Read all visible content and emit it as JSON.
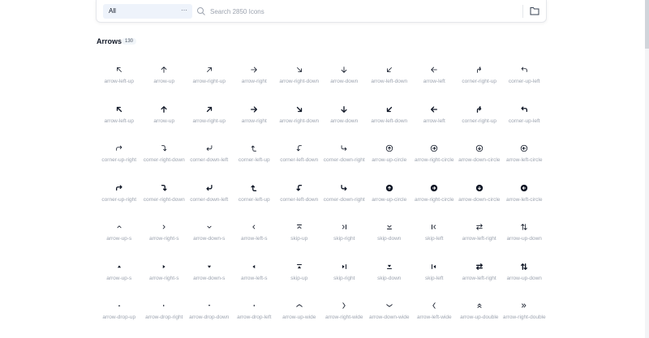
{
  "toolbar": {
    "category_select": "All",
    "search_placeholder": "Search 2850 Icons"
  },
  "section": {
    "title": "Arrows",
    "count": "130"
  },
  "rows": [
    [
      {
        "label": "arrow-left-up",
        "icon": "arrow-left-up-icon"
      },
      {
        "label": "arrow-up",
        "icon": "arrow-up-icon"
      },
      {
        "label": "arrow-right-up",
        "icon": "arrow-right-up-icon"
      },
      {
        "label": "arrow-right",
        "icon": "arrow-right-icon"
      },
      {
        "label": "arrow-right-down",
        "icon": "arrow-right-down-icon"
      },
      {
        "label": "arrow-down",
        "icon": "arrow-down-icon"
      },
      {
        "label": "arrow-left-down",
        "icon": "arrow-left-down-icon"
      },
      {
        "label": "arrow-left",
        "icon": "arrow-left-icon"
      },
      {
        "label": "corner-right-up",
        "icon": "corner-right-up-icon"
      },
      {
        "label": "corner-up-left",
        "icon": "corner-up-left-icon"
      }
    ],
    [
      {
        "label": "arrow-left-up",
        "icon": "arrow-left-up-bold-icon"
      },
      {
        "label": "arrow-up",
        "icon": "arrow-up-bold-icon"
      },
      {
        "label": "arrow-right-up",
        "icon": "arrow-right-up-bold-icon"
      },
      {
        "label": "arrow-right",
        "icon": "arrow-right-bold-icon"
      },
      {
        "label": "arrow-right-down",
        "icon": "arrow-right-down-bold-icon"
      },
      {
        "label": "arrow-down",
        "icon": "arrow-down-bold-icon"
      },
      {
        "label": "arrow-left-down",
        "icon": "arrow-left-down-bold-icon"
      },
      {
        "label": "arrow-left",
        "icon": "arrow-left-bold-icon"
      },
      {
        "label": "corner-right-up",
        "icon": "corner-right-up-bold-icon"
      },
      {
        "label": "corner-up-left",
        "icon": "corner-up-left-bold-icon"
      }
    ],
    [
      {
        "label": "corner-up-right",
        "icon": "corner-up-right-icon"
      },
      {
        "label": "corner-right-down",
        "icon": "corner-right-down-icon"
      },
      {
        "label": "corner-down-left",
        "icon": "corner-down-left-icon"
      },
      {
        "label": "corner-left-up",
        "icon": "corner-left-up-icon"
      },
      {
        "label": "corner-left-down",
        "icon": "corner-left-down-icon"
      },
      {
        "label": "corner-down-right",
        "icon": "corner-down-right-icon"
      },
      {
        "label": "arrow-up-circle",
        "icon": "arrow-up-circle-icon"
      },
      {
        "label": "arrow-right-circle",
        "icon": "arrow-right-circle-icon"
      },
      {
        "label": "arrow-down-circle",
        "icon": "arrow-down-circle-icon"
      },
      {
        "label": "arrow-left-circle",
        "icon": "arrow-left-circle-icon"
      }
    ],
    [
      {
        "label": "corner-up-right",
        "icon": "corner-up-right-bold-icon"
      },
      {
        "label": "corner-right-down",
        "icon": "corner-right-down-bold-icon"
      },
      {
        "label": "corner-down-left",
        "icon": "corner-down-left-bold-icon"
      },
      {
        "label": "corner-left-up",
        "icon": "corner-left-up-bold-icon"
      },
      {
        "label": "corner-left-down",
        "icon": "corner-left-down-bold-icon"
      },
      {
        "label": "corner-down-right",
        "icon": "corner-down-right-bold-icon"
      },
      {
        "label": "arrow-up-circle",
        "icon": "arrow-up-circle-filled-icon"
      },
      {
        "label": "arrow-right-circle",
        "icon": "arrow-right-circle-filled-icon"
      },
      {
        "label": "arrow-down-circle",
        "icon": "arrow-down-circle-filled-icon"
      },
      {
        "label": "arrow-left-circle",
        "icon": "arrow-left-circle-filled-icon"
      }
    ],
    [
      {
        "label": "arrow-up-s",
        "icon": "chevron-up-icon"
      },
      {
        "label": "arrow-right-s",
        "icon": "chevron-right-icon"
      },
      {
        "label": "arrow-down-s",
        "icon": "chevron-down-icon"
      },
      {
        "label": "arrow-left-s",
        "icon": "chevron-left-icon"
      },
      {
        "label": "skip-up",
        "icon": "skip-up-icon"
      },
      {
        "label": "skip-right",
        "icon": "skip-right-icon"
      },
      {
        "label": "skip-down",
        "icon": "skip-down-icon"
      },
      {
        "label": "skip-left",
        "icon": "skip-left-icon"
      },
      {
        "label": "arrow-left-right",
        "icon": "arrow-left-right-icon"
      },
      {
        "label": "arrow-up-down",
        "icon": "arrow-up-down-icon"
      }
    ],
    [
      {
        "label": "arrow-up-s",
        "icon": "triangle-up-icon"
      },
      {
        "label": "arrow-right-s",
        "icon": "triangle-right-icon"
      },
      {
        "label": "arrow-down-s",
        "icon": "triangle-down-icon"
      },
      {
        "label": "arrow-left-s",
        "icon": "triangle-left-icon"
      },
      {
        "label": "skip-up",
        "icon": "skip-up-bold-icon"
      },
      {
        "label": "skip-right",
        "icon": "skip-right-bold-icon"
      },
      {
        "label": "skip-down",
        "icon": "skip-down-bold-icon"
      },
      {
        "label": "skip-left",
        "icon": "skip-left-bold-icon"
      },
      {
        "label": "arrow-left-right",
        "icon": "arrow-left-right-bold-icon"
      },
      {
        "label": "arrow-up-down",
        "icon": "arrow-up-down-bold-icon"
      }
    ],
    [
      {
        "label": "arrow-drop-up",
        "icon": "arrow-drop-up-icon"
      },
      {
        "label": "arrow-drop-right",
        "icon": "arrow-drop-right-icon"
      },
      {
        "label": "arrow-drop-down",
        "icon": "arrow-drop-down-icon"
      },
      {
        "label": "arrow-drop-left",
        "icon": "arrow-drop-left-icon"
      },
      {
        "label": "arrow-up-wide",
        "icon": "arrow-up-wide-icon"
      },
      {
        "label": "arrow-right-wide",
        "icon": "arrow-right-wide-icon"
      },
      {
        "label": "arrow-down-wide",
        "icon": "arrow-down-wide-icon"
      },
      {
        "label": "arrow-left-wide",
        "icon": "arrow-left-wide-icon"
      },
      {
        "label": "arrow-up-double",
        "icon": "arrow-up-double-icon"
      },
      {
        "label": "arrow-right-double",
        "icon": "arrow-right-double-icon"
      }
    ]
  ]
}
